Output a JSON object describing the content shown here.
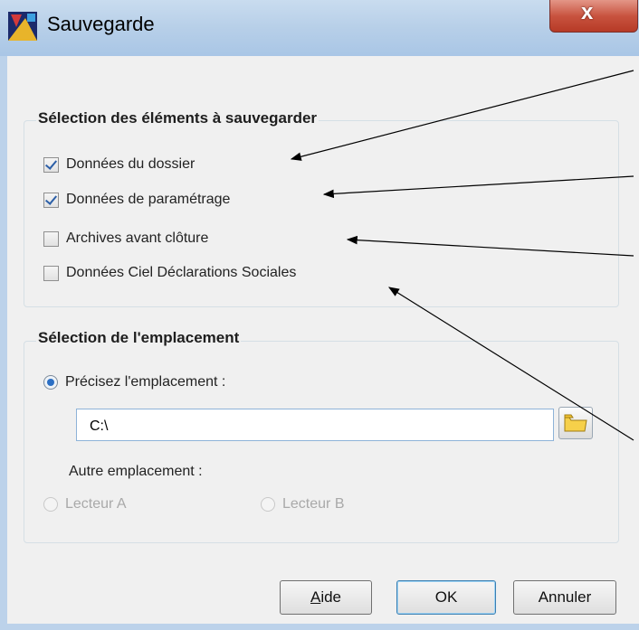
{
  "window": {
    "title": "Sauvegarde",
    "close_glyph": "x"
  },
  "selection_group": {
    "label": "Sélection des éléments à sauvegarder",
    "items": [
      {
        "label": "Données du dossier",
        "checked": true
      },
      {
        "label": "Données de paramétrage",
        "checked": true
      },
      {
        "label": "Archives avant clôture",
        "checked": false
      },
      {
        "label": "Données Ciel Déclarations Sociales",
        "checked": false
      }
    ]
  },
  "location_group": {
    "label": "Sélection de l'emplacement",
    "specify_label": "Précisez l'emplacement :",
    "path_value": "C:\\",
    "other_label": "Autre emplacement :",
    "drive_a": "Lecteur A",
    "drive_b": "Lecteur B"
  },
  "buttons": {
    "help": "Aide",
    "ok": "OK",
    "cancel": "Annuler"
  },
  "icons": {
    "app": "app-icon",
    "folder": "folder-icon",
    "close": "close-icon"
  }
}
